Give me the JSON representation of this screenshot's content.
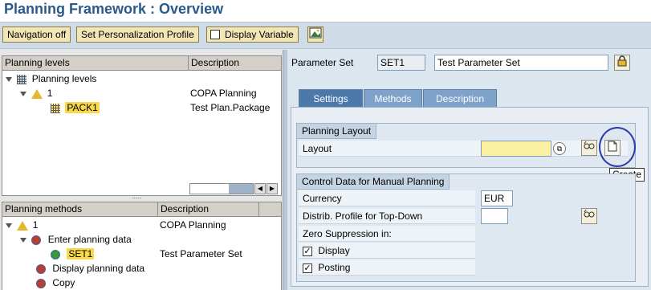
{
  "title": "Planning Framework : Overview",
  "toolbar": {
    "navigation_off": "Navigation off",
    "set_personalization": "Set Personalization Profile",
    "display_variable": "Display Variable"
  },
  "levels_panel": {
    "col_name": "Planning levels",
    "col_desc": "Description",
    "rows": [
      {
        "label": "Planning levels",
        "desc": ""
      },
      {
        "label": "1",
        "desc": "COPA Planning"
      },
      {
        "label": "PACK1",
        "desc": "Test Plan.Package"
      }
    ],
    "splitter": "....."
  },
  "methods_panel": {
    "col_name": "Planning methods",
    "col_desc": "Description",
    "rows": [
      {
        "label": "1",
        "desc": "COPA Planning"
      },
      {
        "label": "Enter planning data",
        "desc": ""
      },
      {
        "label": "SET1",
        "desc": "Test Parameter Set"
      },
      {
        "label": "Display planning data",
        "desc": ""
      },
      {
        "label": "Copy",
        "desc": ""
      }
    ]
  },
  "parameter_set": {
    "label": "Parameter Set",
    "value": "SET1",
    "description": "Test Parameter Set"
  },
  "tabs": [
    {
      "label": "Settings",
      "active": true
    },
    {
      "label": "Methods",
      "active": false
    },
    {
      "label": "Description",
      "active": false
    }
  ],
  "planning_layout": {
    "group_title": "Planning Layout",
    "layout_label": "Layout",
    "layout_value": "",
    "tooltip": "Create"
  },
  "control_data": {
    "group_title": "Control Data for Manual Planning",
    "currency_label": "Currency",
    "currency_value": "EUR",
    "distrib_label": "Distrib. Profile for Top-Down",
    "distrib_value": "",
    "zero_label": "Zero Suppression in:",
    "display_label": "Display",
    "posting_label": "Posting",
    "display_checked": true,
    "posting_checked": true
  },
  "colors": {
    "title": "#2a5a8c",
    "highlight": "#f9d84a",
    "tab_active": "#4c78aa",
    "tab_inactive": "#7ea2c9",
    "circle": "#2d3aa8"
  }
}
